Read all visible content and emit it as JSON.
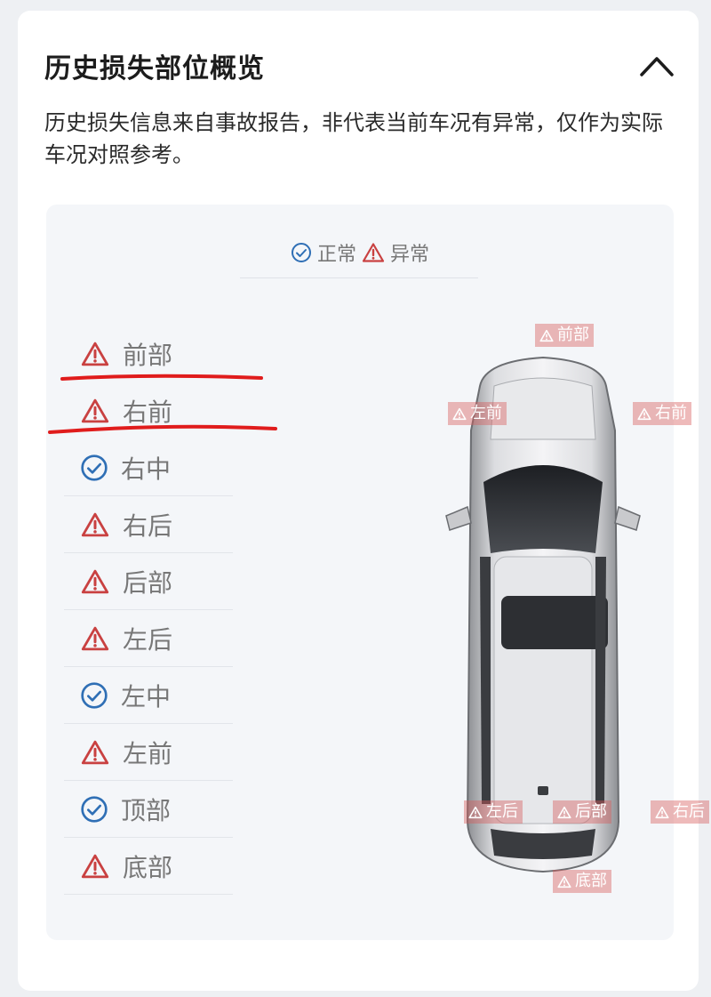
{
  "header": {
    "title": "历史损失部位概览",
    "collapse_icon": "chevron-up-icon"
  },
  "description": "历史损失信息来自事故报告，非代表当前车况有异常，仅作为实际车况对照参考。",
  "legend": {
    "normal_label": "正常",
    "abnormal_label": "异常"
  },
  "status_colors": {
    "normal": "#2f6fb5",
    "abnormal": "#c94141",
    "tag_bg": "#d65a5a"
  },
  "parts": [
    {
      "label": "前部",
      "status": "abnormal"
    },
    {
      "label": "右前",
      "status": "abnormal"
    },
    {
      "label": "右中",
      "status": "normal"
    },
    {
      "label": "右后",
      "status": "abnormal"
    },
    {
      "label": "后部",
      "status": "abnormal"
    },
    {
      "label": "左后",
      "status": "abnormal"
    },
    {
      "label": "左中",
      "status": "normal"
    },
    {
      "label": "左前",
      "status": "abnormal"
    },
    {
      "label": "顶部",
      "status": "normal"
    },
    {
      "label": "底部",
      "status": "abnormal"
    }
  ],
  "car_tags": {
    "front": "前部",
    "left_front": "左前",
    "right_front": "右前",
    "left_rear": "左后",
    "rear": "后部",
    "right_rear": "右后",
    "bottom": "底部"
  }
}
